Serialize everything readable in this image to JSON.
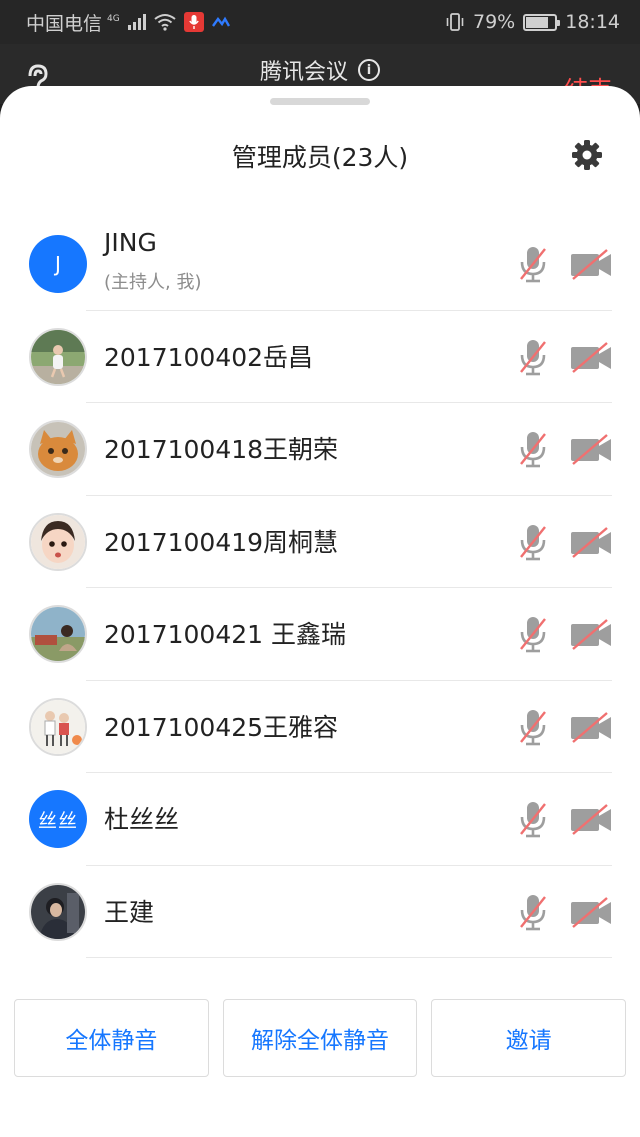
{
  "status_bar": {
    "carrier": "中国电信",
    "network": "4G",
    "battery": "79%",
    "battery_level": 0.79,
    "time": "18:14"
  },
  "meeting": {
    "title": "腾讯会议",
    "end_label": "结束"
  },
  "panel": {
    "title": "管理成员(23人)"
  },
  "members": [
    {
      "name": "JING",
      "subtitle": "(主持人, 我)",
      "avatar": "J",
      "avatar_type": "initial"
    },
    {
      "name": "2017100402岳昌",
      "avatar_type": "photo-girl-running"
    },
    {
      "name": "2017100418王朝荣",
      "avatar_type": "photo-cat"
    },
    {
      "name": "2017100419周桐慧",
      "avatar_type": "photo-baby"
    },
    {
      "name": "2017100421 王鑫瑞",
      "avatar_type": "photo-landscape"
    },
    {
      "name": "2017100425王雅容",
      "avatar_type": "photo-cartoon"
    },
    {
      "name": "杜丝丝",
      "avatar": "丝丝",
      "avatar_type": "text"
    },
    {
      "name": "王建",
      "avatar_type": "photo-portrait"
    }
  ],
  "actions": {
    "mute_all": "全体静音",
    "unmute_all": "解除全体静音",
    "invite": "邀请"
  },
  "colors": {
    "accent": "#1677ff",
    "danger": "#ff4d4d",
    "muted_icon": "#9e9e9e",
    "slash": "#f07070"
  }
}
